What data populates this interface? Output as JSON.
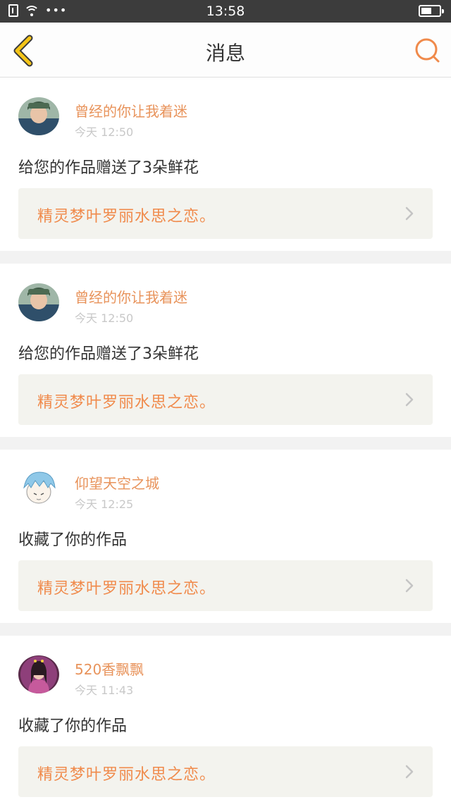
{
  "status_bar": {
    "time": "13:58",
    "icons": [
      "sim-icon",
      "wifi-icon",
      "more-dots-icon",
      "battery-icon"
    ]
  },
  "header": {
    "title": "消息",
    "back_icon": "chevron-left-icon",
    "search_icon": "search-icon"
  },
  "colors": {
    "accent": "#f08a4b",
    "back_icon": "#f5c518",
    "username": "#e8935b",
    "timestamp": "#c8c8c8",
    "link_background": "#f3f3ee"
  },
  "messages": [
    {
      "username": "曾经的你让我着迷",
      "time": "今天 12:50",
      "action": "给您的作品赠送了3朵鲜花",
      "work_title": "精灵梦叶罗丽水思之恋。"
    },
    {
      "username": "曾经的你让我着迷",
      "time": "今天 12:50",
      "action": "给您的作品赠送了3朵鲜花",
      "work_title": "精灵梦叶罗丽水思之恋。"
    },
    {
      "username": "仰望天空之城",
      "time": "今天 12:25",
      "action": "收藏了你的作品",
      "work_title": "精灵梦叶罗丽水思之恋。"
    },
    {
      "username": "520香飘飘",
      "time": "今天 11:43",
      "action": "收藏了你的作品",
      "work_title": "精灵梦叶罗丽水思之恋。"
    }
  ]
}
